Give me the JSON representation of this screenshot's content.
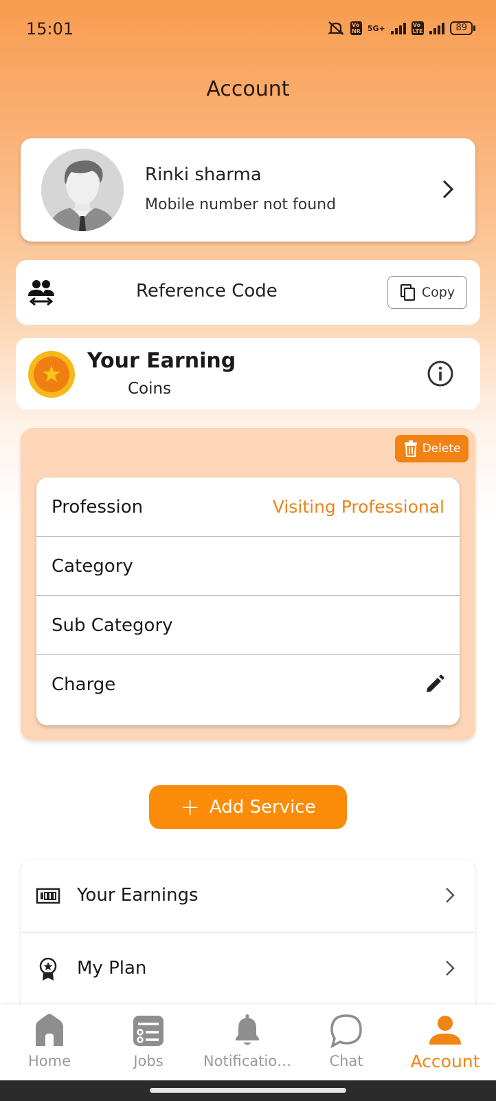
{
  "status_bar": {
    "time": "15:01",
    "network": "5G+",
    "battery": "89"
  },
  "page": {
    "title": "Account"
  },
  "profile": {
    "name": "Rinki sharma",
    "subtitle": "Mobile number not found"
  },
  "reference": {
    "label": "Reference Code",
    "copy_label": "Copy"
  },
  "earning": {
    "title": "Your Earning",
    "subtitle": "Coins"
  },
  "service": {
    "delete_label": "Delete",
    "rows": [
      {
        "label": "Profession",
        "value": "Visiting Professional"
      },
      {
        "label": "Category",
        "value": ""
      },
      {
        "label": "Sub Category",
        "value": ""
      },
      {
        "label": "Charge",
        "value": ""
      }
    ],
    "add_label": "Add Service"
  },
  "menu": {
    "items": [
      {
        "label": "Your Earnings",
        "icon": "money-icon"
      },
      {
        "label": "My Plan",
        "icon": "award-icon"
      }
    ]
  },
  "bottom_nav": {
    "items": [
      {
        "label": "Home",
        "icon": "home-icon"
      },
      {
        "label": "Jobs",
        "icon": "list-icon"
      },
      {
        "label": "Notificatio…",
        "icon": "bell-icon"
      },
      {
        "label": "Chat",
        "icon": "chat-icon"
      },
      {
        "label": "Account",
        "icon": "person-icon",
        "active": true
      }
    ]
  },
  "colors": {
    "accent": "#fb8c0a",
    "header_gradient_top": "#f89c4f",
    "service_box": "#fcd6b6",
    "active_nav": "#f08512",
    "value_text": "#e8841c"
  }
}
